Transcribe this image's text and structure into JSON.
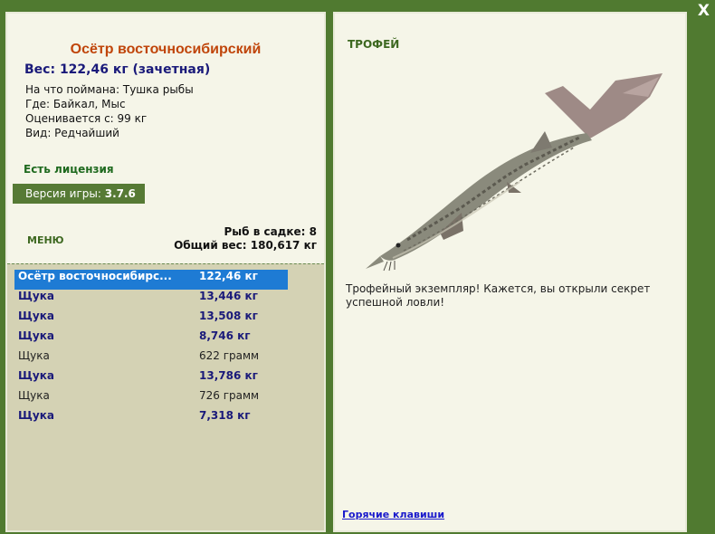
{
  "window": {
    "close_label": "X"
  },
  "fish": {
    "name": "Осётр восточносибирский",
    "weight": "Вес: 122,46 кг (зачетная)",
    "bait": "На что поймана: Тушка рыбы",
    "place": "Где: Байкал, Мыс",
    "value": "Оценивается с: 99 кг",
    "rarity": "Вид: Редчайший"
  },
  "license": "Есть лицензия",
  "version": {
    "prefix": "Версия игры: ",
    "number": "3.7.6"
  },
  "menu_label": "МЕНЮ",
  "cage": {
    "count": "Рыб в садке: 8",
    "total": "Общий вес: 180,617 кг"
  },
  "catch_list": [
    {
      "name": "Осётр восточносибирс...",
      "weight": "122,46 кг"
    },
    {
      "name": "Щука",
      "weight": "13,446 кг"
    },
    {
      "name": "Щука",
      "weight": "13,508 кг"
    },
    {
      "name": "Щука",
      "weight": "8,746 кг"
    },
    {
      "name": "Щука",
      "weight": "622 грамм"
    },
    {
      "name": "Щука",
      "weight": "13,786 кг"
    },
    {
      "name": "Щука",
      "weight": "726 грамм"
    },
    {
      "name": "Щука",
      "weight": "7,318 кг"
    }
  ],
  "trophy": {
    "label": "ТРОФЕЙ",
    "message": "Трофейный экземпляр! Кажется, вы открыли секрет успешной ловли!"
  },
  "hotkeys_label": "Горячие клавиши",
  "colors": {
    "background": "#507a30",
    "selected_row": "#1e7bd4",
    "title": "#c0450a",
    "license": "#1f6a1f"
  }
}
